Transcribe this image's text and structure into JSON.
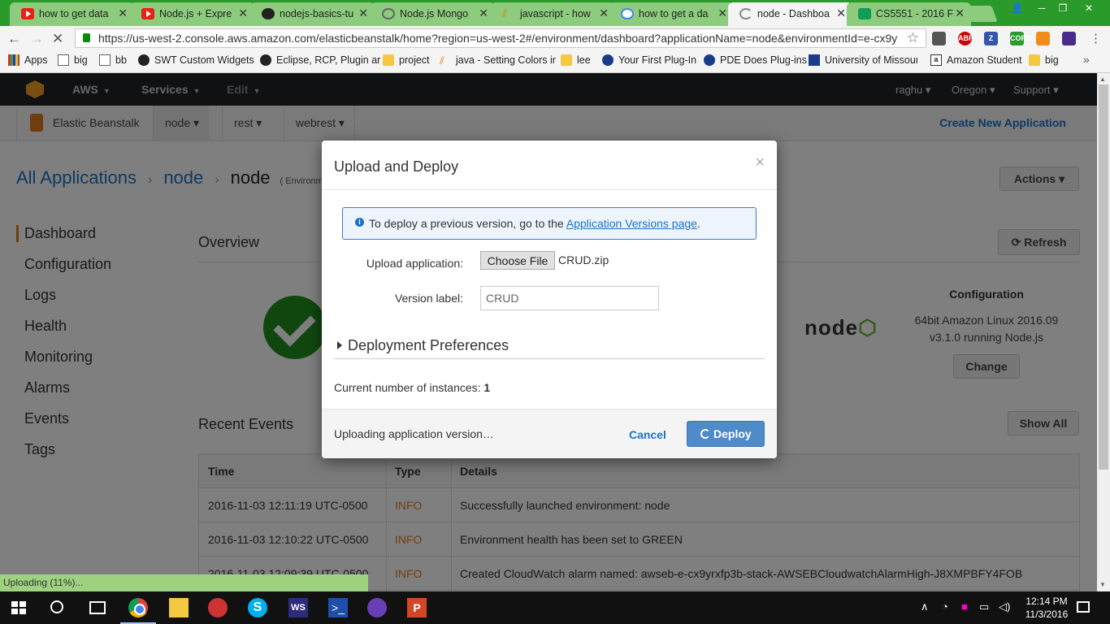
{
  "browser": {
    "tabs": [
      {
        "label": "how to get data",
        "icon": "youtube-icon",
        "active": false
      },
      {
        "label": "Node.js + Expre",
        "icon": "youtube-icon",
        "active": false
      },
      {
        "label": "nodejs-basics-tu",
        "icon": "github-icon",
        "active": false
      },
      {
        "label": "Node.js Mongo",
        "icon": "mongo-icon",
        "active": false
      },
      {
        "label": "javascript - how",
        "icon": "stackoverflow-icon",
        "active": false
      },
      {
        "label": "how to get a da",
        "icon": "google-icon",
        "active": false
      },
      {
        "label": "node - Dashboa",
        "icon": "loading-spinner-icon",
        "active": true
      },
      {
        "label": "CS5551 - 2016 F",
        "icon": "sheets-icon",
        "active": false
      }
    ],
    "url": "https://us-west-2.console.aws.amazon.com/elasticbeanstalk/home?region=us-west-2#/environment/dashboard?applicationName=node&environmentId=e-cx9y",
    "bookmarks": [
      {
        "label": "Apps",
        "icon": "apps-grid-icon"
      },
      {
        "label": "big",
        "icon": "page-icon"
      },
      {
        "label": "bb",
        "icon": "page-icon"
      },
      {
        "label": "SWT Custom Widgets",
        "icon": "site-icon"
      },
      {
        "label": "Eclipse, RCP, Plugin ar",
        "icon": "site-icon"
      },
      {
        "label": "project",
        "icon": "folder-icon"
      },
      {
        "label": "java - Setting Colors ir",
        "icon": "stackoverflow-icon"
      },
      {
        "label": "lee",
        "icon": "folder-icon"
      },
      {
        "label": "Your First Plug-In",
        "icon": "eclipse-icon"
      },
      {
        "label": "PDE Does Plug-ins",
        "icon": "eclipse-icon"
      },
      {
        "label": "University of Missouri",
        "icon": "university-icon"
      },
      {
        "label": "Amazon Student",
        "icon": "amazon-icon"
      },
      {
        "label": "big",
        "icon": "folder-icon"
      }
    ],
    "status_text": "Uploading (11%)...",
    "upload_progress": 0.11
  },
  "aws": {
    "brand": "AWS",
    "nav": [
      "Services",
      "Edit"
    ],
    "right": [
      "raghu",
      "Oregon",
      "Support"
    ],
    "service_name": "Elastic Beanstalk",
    "app_tabs": [
      "node",
      "rest",
      "webrest"
    ],
    "create_app": "Create New Application",
    "breadcrumb": [
      "All Applications",
      "node",
      "node"
    ],
    "env_suffix": "( Environm",
    "actions": "Actions",
    "sidebar": [
      "Dashboard",
      "Configuration",
      "Logs",
      "Health",
      "Monitoring",
      "Alarms",
      "Events",
      "Tags"
    ],
    "overview_title": "Overview",
    "refresh": "Refresh",
    "node_logo": "node",
    "configuration": {
      "title": "Configuration",
      "line1": "64bit Amazon Linux 2016.09",
      "line2": "v3.1.0 running Node.js",
      "change": "Change"
    },
    "recent_events_title": "Recent Events",
    "show_all": "Show All",
    "events": {
      "headers": [
        "Time",
        "Type",
        "Details"
      ],
      "rows": [
        {
          "time": "2016-11-03 12:11:19 UTC-0500",
          "type": "INFO",
          "details": "Successfully launched environment: node"
        },
        {
          "time": "2016-11-03 12:10:22 UTC-0500",
          "type": "INFO",
          "details": "Environment health has been set to GREEN"
        },
        {
          "time": "2016-11-03 12:09:39 UTC-0500",
          "type": "INFO",
          "details": "Created CloudWatch alarm named: awseb-e-cx9yrxfp3b-stack-AWSEBCloudwatchAlarmHigh-J8XMPBFY4FOB"
        }
      ]
    }
  },
  "modal": {
    "title": "Upload and Deploy",
    "close": "×",
    "alert_text": "To deploy a previous version, go to the",
    "alert_link": "Application Versions page",
    "alert_end": ".",
    "upload_label": "Upload application:",
    "choose_file": "Choose File",
    "file_name": "CRUD.zip",
    "version_label": "Version label:",
    "version_value": "CRUD",
    "deployment_prefs": "Deployment Preferences",
    "instances_label": "Current number of instances:",
    "instances_count": "1",
    "status": "Uploading application version…",
    "cancel": "Cancel",
    "deploy": "Deploy"
  },
  "taskbar": {
    "time": "12:14 PM",
    "date": "11/3/2016"
  }
}
